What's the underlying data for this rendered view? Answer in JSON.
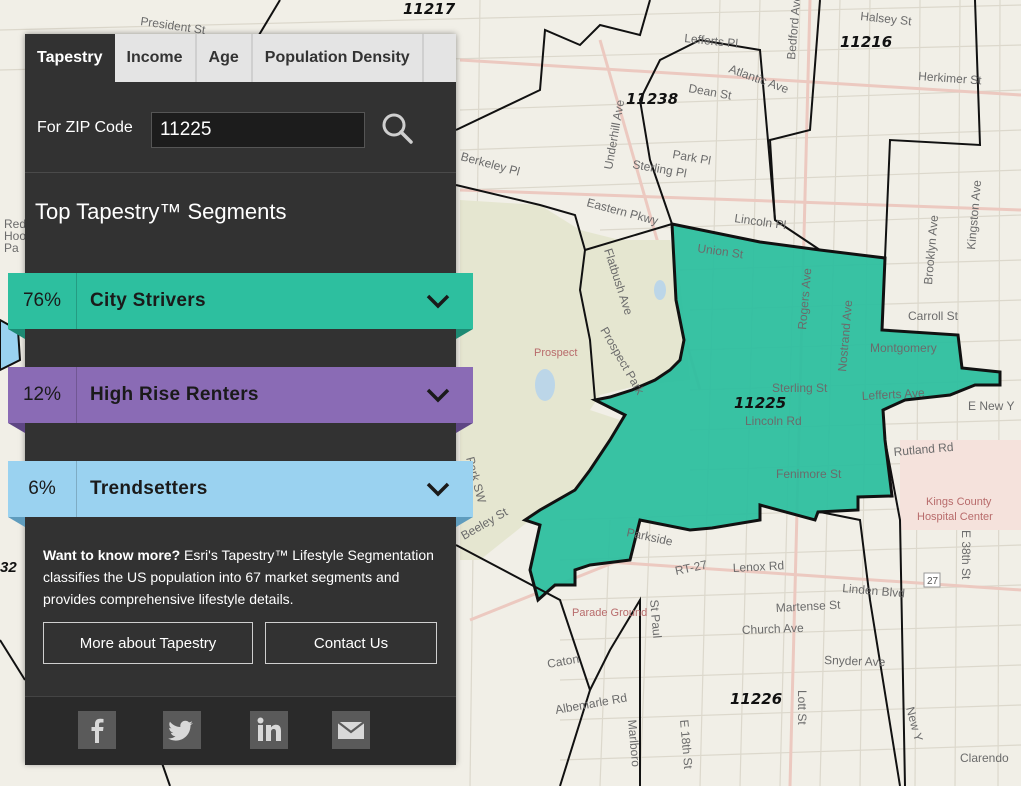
{
  "map": {
    "zip_labels": [
      {
        "code": "11217"
      },
      {
        "code": "11216"
      },
      {
        "code": "11238"
      },
      {
        "code": "11225"
      },
      {
        "code": "11226"
      }
    ],
    "street_labels": [
      "President St",
      "Lefferts Pl",
      "Halsey St",
      "Atlantic Ave",
      "Herkimer St",
      "Dean St",
      "Bedford Ave",
      "Park Pl",
      "Sterling Pl",
      "Berkeley Pl",
      "Eastern Pkwy",
      "Lincoln Pl",
      "Union St",
      "Underhill Ave",
      "Flatbush Ave",
      "Prospect Park",
      "Rogers Ave",
      "Nostrand Ave",
      "Carroll St",
      "Montgomery",
      "Sterling St",
      "Lefferts Ave",
      "E New Y",
      "Lincoln Rd",
      "Fenimore St",
      "Rutland Rd",
      "Brooklyn Ave",
      "Kingston Ave",
      "Lenox Rd",
      "Linden Blvd",
      "Martense St",
      "Church Ave",
      "Snyder Ave",
      "Parkside",
      "Caton",
      "Albemarle Rd",
      "E 18th St",
      "Lott St",
      "E 38th St",
      "Clarendo",
      "RT-27",
      "Park SW",
      "Beeley St",
      "St Paul",
      "Marlboro",
      "New Y"
    ],
    "poi_labels": [
      "Kings County",
      "Hospital Center",
      "Parade Ground",
      "Prospect"
    ],
    "edge_fragments": [
      "32",
      "Red",
      "Hoo",
      "Pa"
    ],
    "route_shield": "27",
    "highlight_color": "#2dbf9f"
  },
  "panel": {
    "tabs": [
      {
        "label": "Tapestry",
        "active": true
      },
      {
        "label": "Income",
        "active": false
      },
      {
        "label": "Age",
        "active": false
      },
      {
        "label": "Population Density",
        "active": false
      }
    ],
    "zip_label": "For ZIP Code",
    "zip_value": "11225",
    "segments_title": "Top Tapestry™ Segments",
    "segments": [
      {
        "percent": "76%",
        "name": "City Strivers",
        "color": "#2dbf9f",
        "fold": "#1d8a73"
      },
      {
        "percent": "12%",
        "name": "High Rise Renters",
        "color": "#8a6bb5",
        "fold": "#5e4684"
      },
      {
        "percent": "6%",
        "name": "Trendsetters",
        "color": "#9ad2f0",
        "fold": "#5f9cbd"
      }
    ],
    "info_bold": "Want to know more?",
    "info_text": " Esri's Tapestry™ Lifestyle Segmentation classifies the US population into 67 market segments and provides comprehensive lifestyle details.",
    "more_button": "More about Tapestry",
    "contact_button": "Contact Us",
    "social": [
      "facebook-icon",
      "twitter-icon",
      "linkedin-icon",
      "email-icon"
    ]
  }
}
